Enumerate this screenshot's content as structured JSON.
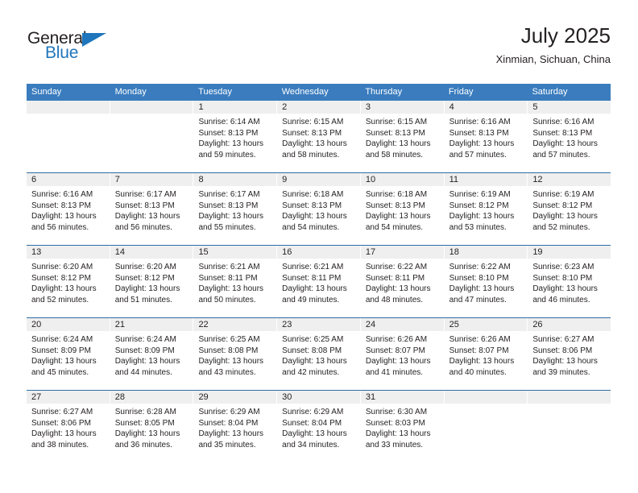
{
  "brand": {
    "name_top": "General",
    "name_bottom": "Blue"
  },
  "header": {
    "title": "July 2025",
    "subtitle": "Xinmian, Sichuan, China"
  },
  "calendar": {
    "weekday_headers": [
      "Sunday",
      "Monday",
      "Tuesday",
      "Wednesday",
      "Thursday",
      "Friday",
      "Saturday"
    ],
    "accent_color": "#3a7cbe",
    "row_rule_color": "#2e6da4",
    "daynum_band_color": "#efefef",
    "weeks": [
      [
        {
          "day": ""
        },
        {
          "day": ""
        },
        {
          "day": "1",
          "sunrise": "Sunrise: 6:14 AM",
          "sunset": "Sunset: 8:13 PM",
          "daylight": "Daylight: 13 hours and 59 minutes."
        },
        {
          "day": "2",
          "sunrise": "Sunrise: 6:15 AM",
          "sunset": "Sunset: 8:13 PM",
          "daylight": "Daylight: 13 hours and 58 minutes."
        },
        {
          "day": "3",
          "sunrise": "Sunrise: 6:15 AM",
          "sunset": "Sunset: 8:13 PM",
          "daylight": "Daylight: 13 hours and 58 minutes."
        },
        {
          "day": "4",
          "sunrise": "Sunrise: 6:16 AM",
          "sunset": "Sunset: 8:13 PM",
          "daylight": "Daylight: 13 hours and 57 minutes."
        },
        {
          "day": "5",
          "sunrise": "Sunrise: 6:16 AM",
          "sunset": "Sunset: 8:13 PM",
          "daylight": "Daylight: 13 hours and 57 minutes."
        }
      ],
      [
        {
          "day": "6",
          "sunrise": "Sunrise: 6:16 AM",
          "sunset": "Sunset: 8:13 PM",
          "daylight": "Daylight: 13 hours and 56 minutes."
        },
        {
          "day": "7",
          "sunrise": "Sunrise: 6:17 AM",
          "sunset": "Sunset: 8:13 PM",
          "daylight": "Daylight: 13 hours and 56 minutes."
        },
        {
          "day": "8",
          "sunrise": "Sunrise: 6:17 AM",
          "sunset": "Sunset: 8:13 PM",
          "daylight": "Daylight: 13 hours and 55 minutes."
        },
        {
          "day": "9",
          "sunrise": "Sunrise: 6:18 AM",
          "sunset": "Sunset: 8:13 PM",
          "daylight": "Daylight: 13 hours and 54 minutes."
        },
        {
          "day": "10",
          "sunrise": "Sunrise: 6:18 AM",
          "sunset": "Sunset: 8:13 PM",
          "daylight": "Daylight: 13 hours and 54 minutes."
        },
        {
          "day": "11",
          "sunrise": "Sunrise: 6:19 AM",
          "sunset": "Sunset: 8:12 PM",
          "daylight": "Daylight: 13 hours and 53 minutes."
        },
        {
          "day": "12",
          "sunrise": "Sunrise: 6:19 AM",
          "sunset": "Sunset: 8:12 PM",
          "daylight": "Daylight: 13 hours and 52 minutes."
        }
      ],
      [
        {
          "day": "13",
          "sunrise": "Sunrise: 6:20 AM",
          "sunset": "Sunset: 8:12 PM",
          "daylight": "Daylight: 13 hours and 52 minutes."
        },
        {
          "day": "14",
          "sunrise": "Sunrise: 6:20 AM",
          "sunset": "Sunset: 8:12 PM",
          "daylight": "Daylight: 13 hours and 51 minutes."
        },
        {
          "day": "15",
          "sunrise": "Sunrise: 6:21 AM",
          "sunset": "Sunset: 8:11 PM",
          "daylight": "Daylight: 13 hours and 50 minutes."
        },
        {
          "day": "16",
          "sunrise": "Sunrise: 6:21 AM",
          "sunset": "Sunset: 8:11 PM",
          "daylight": "Daylight: 13 hours and 49 minutes."
        },
        {
          "day": "17",
          "sunrise": "Sunrise: 6:22 AM",
          "sunset": "Sunset: 8:11 PM",
          "daylight": "Daylight: 13 hours and 48 minutes."
        },
        {
          "day": "18",
          "sunrise": "Sunrise: 6:22 AM",
          "sunset": "Sunset: 8:10 PM",
          "daylight": "Daylight: 13 hours and 47 minutes."
        },
        {
          "day": "19",
          "sunrise": "Sunrise: 6:23 AM",
          "sunset": "Sunset: 8:10 PM",
          "daylight": "Daylight: 13 hours and 46 minutes."
        }
      ],
      [
        {
          "day": "20",
          "sunrise": "Sunrise: 6:24 AM",
          "sunset": "Sunset: 8:09 PM",
          "daylight": "Daylight: 13 hours and 45 minutes."
        },
        {
          "day": "21",
          "sunrise": "Sunrise: 6:24 AM",
          "sunset": "Sunset: 8:09 PM",
          "daylight": "Daylight: 13 hours and 44 minutes."
        },
        {
          "day": "22",
          "sunrise": "Sunrise: 6:25 AM",
          "sunset": "Sunset: 8:08 PM",
          "daylight": "Daylight: 13 hours and 43 minutes."
        },
        {
          "day": "23",
          "sunrise": "Sunrise: 6:25 AM",
          "sunset": "Sunset: 8:08 PM",
          "daylight": "Daylight: 13 hours and 42 minutes."
        },
        {
          "day": "24",
          "sunrise": "Sunrise: 6:26 AM",
          "sunset": "Sunset: 8:07 PM",
          "daylight": "Daylight: 13 hours and 41 minutes."
        },
        {
          "day": "25",
          "sunrise": "Sunrise: 6:26 AM",
          "sunset": "Sunset: 8:07 PM",
          "daylight": "Daylight: 13 hours and 40 minutes."
        },
        {
          "day": "26",
          "sunrise": "Sunrise: 6:27 AM",
          "sunset": "Sunset: 8:06 PM",
          "daylight": "Daylight: 13 hours and 39 minutes."
        }
      ],
      [
        {
          "day": "27",
          "sunrise": "Sunrise: 6:27 AM",
          "sunset": "Sunset: 8:06 PM",
          "daylight": "Daylight: 13 hours and 38 minutes."
        },
        {
          "day": "28",
          "sunrise": "Sunrise: 6:28 AM",
          "sunset": "Sunset: 8:05 PM",
          "daylight": "Daylight: 13 hours and 36 minutes."
        },
        {
          "day": "29",
          "sunrise": "Sunrise: 6:29 AM",
          "sunset": "Sunset: 8:04 PM",
          "daylight": "Daylight: 13 hours and 35 minutes."
        },
        {
          "day": "30",
          "sunrise": "Sunrise: 6:29 AM",
          "sunset": "Sunset: 8:04 PM",
          "daylight": "Daylight: 13 hours and 34 minutes."
        },
        {
          "day": "31",
          "sunrise": "Sunrise: 6:30 AM",
          "sunset": "Sunset: 8:03 PM",
          "daylight": "Daylight: 13 hours and 33 minutes."
        },
        {
          "day": ""
        },
        {
          "day": ""
        }
      ]
    ]
  }
}
